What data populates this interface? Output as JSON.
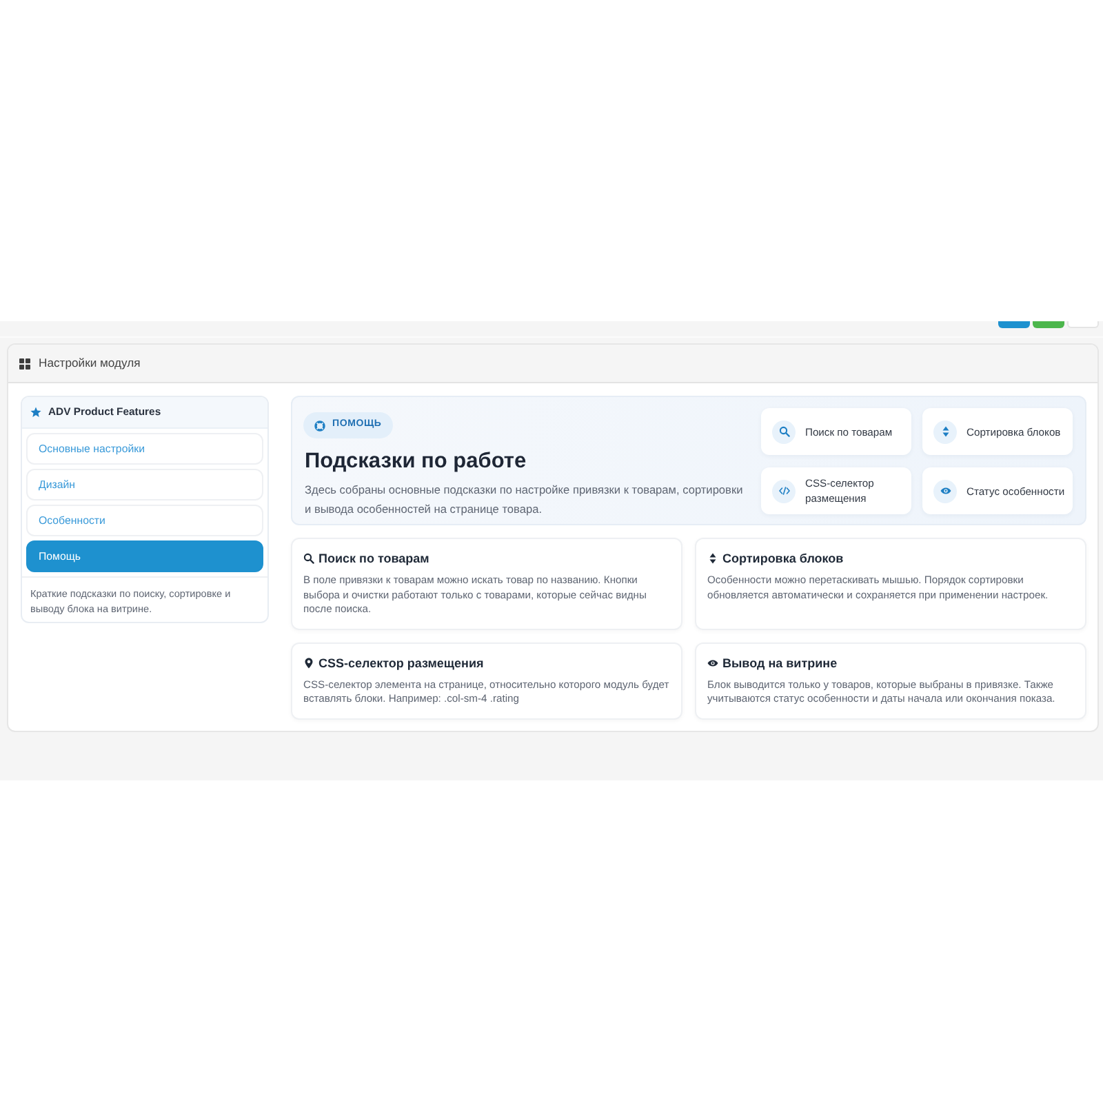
{
  "module_panel": {
    "title": "Настройки модуля"
  },
  "sidebar": {
    "title": "ADV Product Features",
    "items": [
      {
        "label": "Основные настройки",
        "selected": false
      },
      {
        "label": "Дизайн",
        "selected": false
      },
      {
        "label": "Особенности",
        "selected": false
      },
      {
        "label": "Помощь",
        "selected": true
      }
    ],
    "note": "Краткие подсказки по поиску, сортировке и выводу блока на витрине."
  },
  "hero": {
    "badge": "ПОМОЩЬ",
    "title": "Подсказки по работе",
    "description": "Здесь собраны основные подсказки по настройке привязки к товарам, сортировки и вывода особенностей на странице товара.",
    "tiles": [
      {
        "kind": "search",
        "label": "Поиск по товарам"
      },
      {
        "kind": "sorting",
        "label": "Сортировка блоков"
      },
      {
        "kind": "selector",
        "label": "CSS-селектор размещения"
      },
      {
        "kind": "status",
        "label": "Статус особенности"
      }
    ]
  },
  "cards": [
    {
      "kind": "search",
      "title": "Поиск по товарам",
      "text": "В поле привязки к товарам можно искать товар по названию. Кнопки выбора и очистки работают только с товарами, которые сейчас видны после поиска."
    },
    {
      "kind": "sorting",
      "title": "Сортировка блоков",
      "text": "Особенности можно перетаскивать мышью. Порядок сортировки обновляется автоматически и сохраняется при применении настроек."
    },
    {
      "kind": "selector",
      "title": "CSS-селектор размещения",
      "text": "CSS-селектор элемента на странице, относительно которого модуль будет вставлять блоки. Например: .col-sm-4 .rating"
    },
    {
      "kind": "display",
      "title": "Вывод на витрине",
      "text": "Блок выводится только у товаров, которые выбраны в привязке. Также учитываются статус особенности и даты начала или окончания показа."
    }
  ]
}
